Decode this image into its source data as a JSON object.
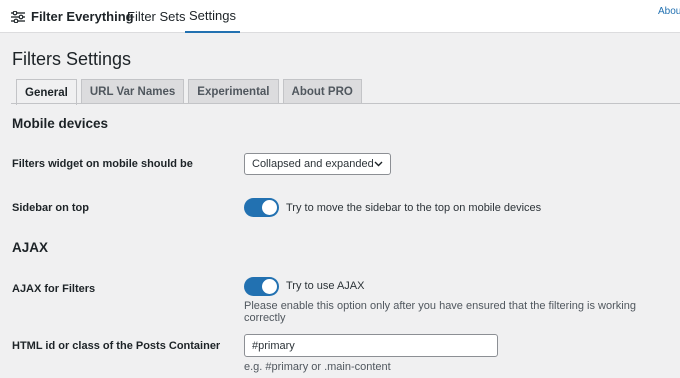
{
  "topbar": {
    "brand": "Filter Everything",
    "nav": [
      "Filter Sets",
      "Settings"
    ],
    "about_link": "About"
  },
  "page_title": "Filters Settings",
  "tabs": [
    "General",
    "URL Var Names",
    "Experimental",
    "About PRO"
  ],
  "active_tab": "General",
  "accent_color": "#2271b1",
  "sections": {
    "mobile": {
      "heading": "Mobile devices",
      "widget_label": "Filters widget on mobile should be",
      "widget_value": "Collapsed and expanded",
      "sidebar_label": "Sidebar on top",
      "sidebar_toggle_text": "Try to move the sidebar to the top on mobile devices",
      "sidebar_toggle_on": true
    },
    "ajax": {
      "heading": "AJAX",
      "ajax_label": "AJAX for Filters",
      "ajax_toggle_text": "Try to use AJAX",
      "ajax_toggle_on": true,
      "ajax_help": "Please enable this option only after you have ensured that the filtering is working correctly",
      "container_label": "HTML id or class of the Posts Container",
      "container_value": "#primary",
      "container_help": "e.g. #primary or .main-content"
    }
  }
}
